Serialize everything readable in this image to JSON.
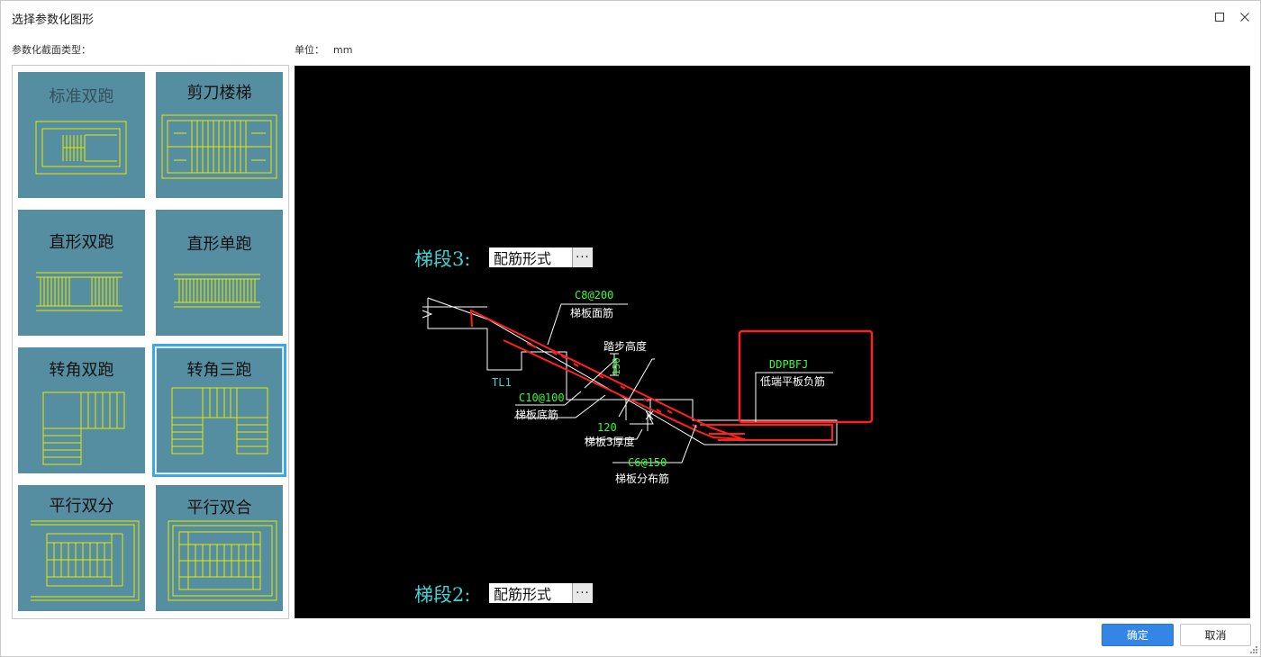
{
  "window": {
    "title": "选择参数化图形",
    "maximize_icon": "maximize-icon",
    "close_icon": "close-icon"
  },
  "labels": {
    "section_types": "参数化截面类型：",
    "unit_label": "单位：",
    "unit_value": "mm"
  },
  "gallery": {
    "tiles": [
      {
        "label": "标准双跑",
        "selected": false
      },
      {
        "label": "剪刀楼梯",
        "selected": false
      },
      {
        "label": "直形双跑",
        "selected": false
      },
      {
        "label": "直形单跑",
        "selected": false
      },
      {
        "label": "转角双跑",
        "selected": false
      },
      {
        "label": "转角三跑",
        "selected": true
      },
      {
        "label": "平行双分",
        "selected": false
      },
      {
        "label": "平行双合",
        "selected": false
      }
    ]
  },
  "drawing": {
    "segment3_label": "梯段3:",
    "segment3_value": "配筋形式",
    "segment2_label": "梯段2:",
    "segment2_value": "配筋形式",
    "ellipsis": "···",
    "annotations": {
      "c8": "C8@200",
      "top_rebar": "梯板面筋",
      "step_height": "踏步高度",
      "h150": "150",
      "tl1": "TL1",
      "c10": "C10@100",
      "bottom_rebar": "梯板底筋",
      "n120": "120",
      "thickness": "梯板3厚度",
      "c6": "C6@150",
      "dist_rebar": "梯板分布筋",
      "ddpbfj": "DDPBFJ",
      "low_slab_neg": "低端平板负筋"
    },
    "colors": {
      "canvas_bg": "#000000",
      "outline": "#ffffff",
      "rebar": "#ff2020",
      "code_text": "#33ff33",
      "segment_label": "#3fd3d3",
      "tile_bg": "#568ea1",
      "tile_line": "#e8e800"
    }
  },
  "buttons": {
    "ok": "确定",
    "cancel": "取消"
  }
}
